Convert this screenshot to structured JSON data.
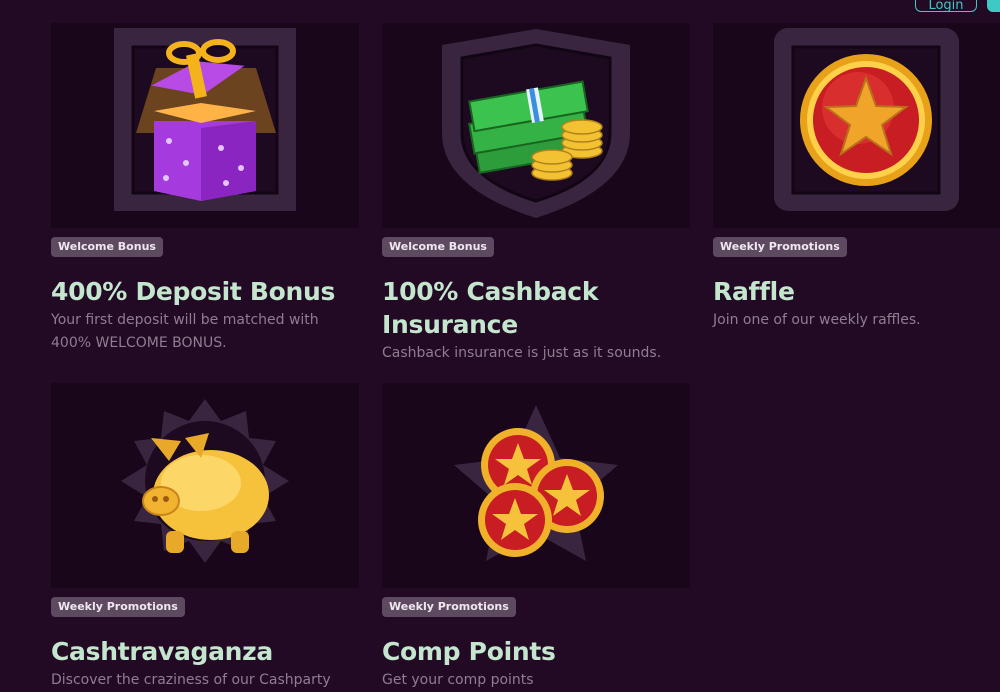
{
  "header": {
    "login_label": "Login"
  },
  "cards": [
    {
      "badge": "Welcome Bonus",
      "title": "400% Deposit Bonus",
      "description": "Your first deposit will be matched with 400% WELCOME BONUS.",
      "icon": "gift-box-icon"
    },
    {
      "badge": "Welcome Bonus",
      "title": "100% Cashback Insurance",
      "description": "Cashback insurance is just as it sounds.",
      "icon": "cash-coins-icon"
    },
    {
      "badge": "Weekly Promotions",
      "title": "Raffle",
      "description": "Join one of our weekly raffles.",
      "icon": "star-medal-icon"
    },
    {
      "badge": "Weekly Promotions",
      "title": "Cashtravaganza",
      "description": "Discover the craziness of our Cashparty",
      "icon": "piggy-bank-icon"
    },
    {
      "badge": "Weekly Promotions",
      "title": "Comp Points",
      "description": "Get your comp points",
      "icon": "star-coins-icon"
    }
  ],
  "colors": {
    "background": "#230a24",
    "card_image_bg": "#19061a",
    "badge_bg": "#5e4a60",
    "title": "#c4e6cf",
    "description": "#8f7d92",
    "accent": "#3fc9c6"
  }
}
